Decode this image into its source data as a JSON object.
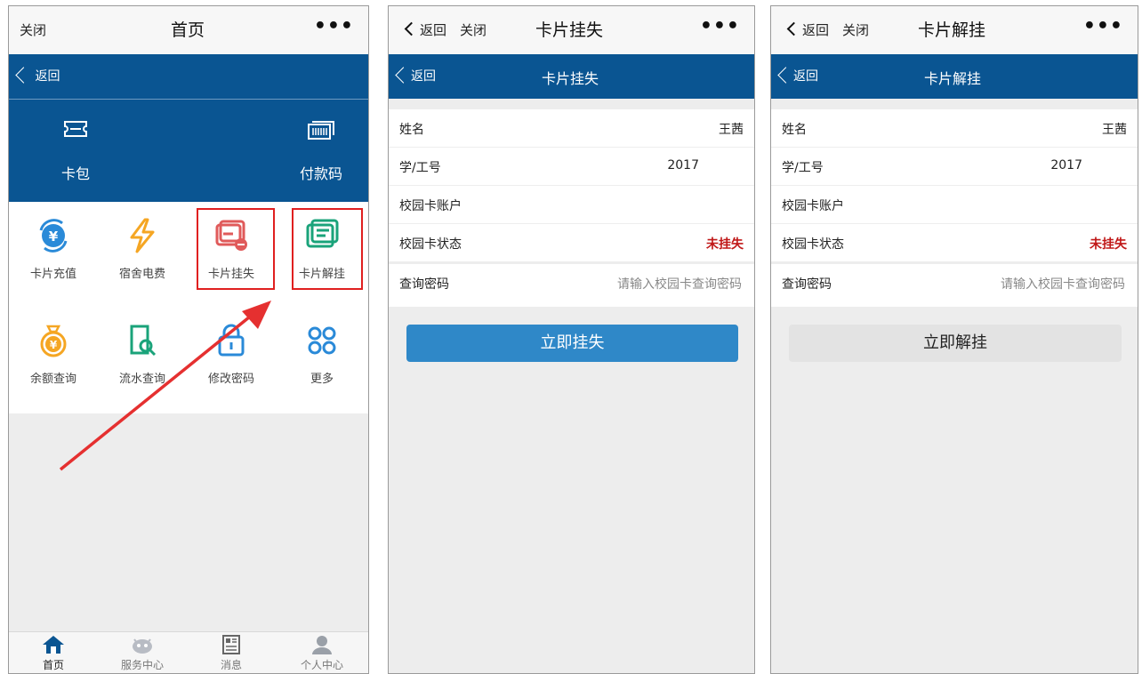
{
  "home": {
    "topbar": {
      "close": "关闭",
      "title": "首页",
      "more": "•••"
    },
    "bluebar": {
      "back": "返回"
    },
    "hero": [
      {
        "label": "卡包",
        "icon": "ticket-icon"
      },
      {
        "label": "付款码",
        "icon": "barcode-icon"
      }
    ],
    "grid": [
      {
        "label": "卡片充值",
        "icon": "recharge-yen-icon"
      },
      {
        "label": "宿舍电费",
        "icon": "lightning-icon"
      },
      {
        "label": "卡片挂失",
        "icon": "card-loss-icon"
      },
      {
        "label": "卡片解挂",
        "icon": "card-unlock-icon"
      },
      {
        "label": "余额查询",
        "icon": "money-bag-icon"
      },
      {
        "label": "流水查询",
        "icon": "statement-search-icon"
      },
      {
        "label": "修改密码",
        "icon": "lock-icon"
      },
      {
        "label": "更多",
        "icon": "more-grid-icon"
      }
    ],
    "tabs": [
      {
        "label": "首页",
        "icon": "home-icon"
      },
      {
        "label": "服务中心",
        "icon": "service-icon"
      },
      {
        "label": "消息",
        "icon": "message-icon"
      },
      {
        "label": "个人中心",
        "icon": "user-icon"
      }
    ]
  },
  "loss": {
    "topbar": {
      "back": "返回",
      "close": "关闭",
      "title": "卡片挂失",
      "more": "•••"
    },
    "bluebar": {
      "back": "返回",
      "title": "卡片挂失"
    },
    "rows": [
      {
        "key": "姓名",
        "value": "王茜"
      },
      {
        "key": "学/工号",
        "value": "2017"
      },
      {
        "key": "校园卡账户",
        "value": ""
      },
      {
        "key": "校园卡状态",
        "value": "未挂失"
      }
    ],
    "password": {
      "label": "查询密码",
      "placeholder": "请输入校园卡查询密码"
    },
    "button": "立即挂失"
  },
  "unlock": {
    "topbar": {
      "back": "返回",
      "close": "关闭",
      "title": "卡片解挂",
      "more": "•••"
    },
    "bluebar": {
      "back": "返回",
      "title": "卡片解挂"
    },
    "rows": [
      {
        "key": "姓名",
        "value": "王茜"
      },
      {
        "key": "学/工号",
        "value": "2017"
      },
      {
        "key": "校园卡账户",
        "value": ""
      },
      {
        "key": "校园卡状态",
        "value": "未挂失"
      }
    ],
    "password": {
      "label": "查询密码",
      "placeholder": "请输入校园卡查询密码"
    },
    "button": "立即解挂"
  },
  "colors": {
    "brand_blue": "#0a5592",
    "button_blue": "#2f88c8",
    "status_red": "#c01818",
    "highlight_red": "#e02020",
    "orange": "#f5a623",
    "teal": "#1aa37a",
    "icon_blue": "#2a8ad8",
    "card_red": "#e05a5a"
  }
}
